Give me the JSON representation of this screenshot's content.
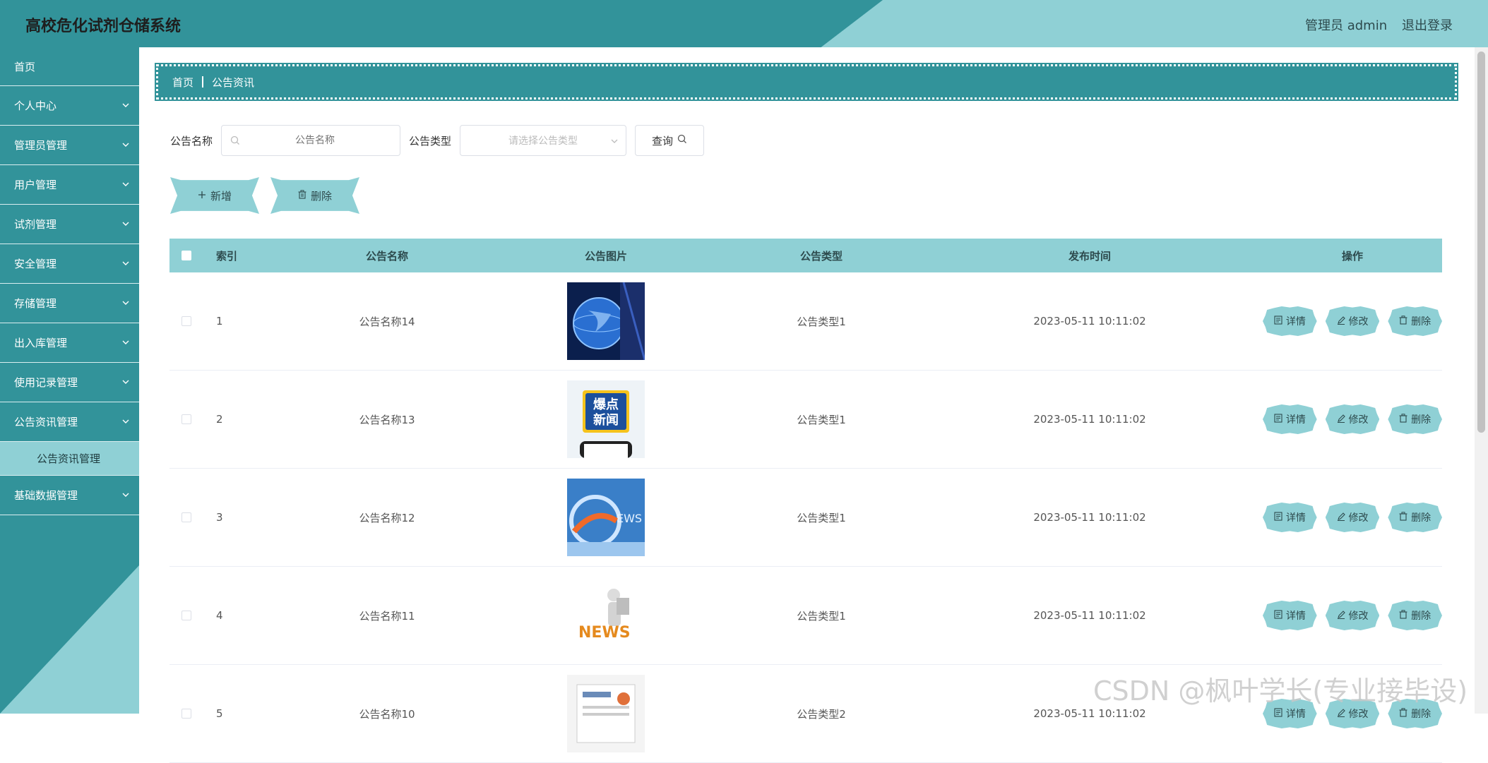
{
  "header": {
    "title": "高校危化试剂仓储系统",
    "user_label": "管理员 admin",
    "logout_label": "退出登录",
    "colors": {
      "dark": "#32939a",
      "light": "#8fd0d5"
    }
  },
  "sidebar": {
    "items": [
      {
        "label": "首页",
        "has_chevron": false
      },
      {
        "label": "个人中心",
        "has_chevron": true
      },
      {
        "label": "管理员管理",
        "has_chevron": true
      },
      {
        "label": "用户管理",
        "has_chevron": true
      },
      {
        "label": "试剂管理",
        "has_chevron": true
      },
      {
        "label": "安全管理",
        "has_chevron": true
      },
      {
        "label": "存储管理",
        "has_chevron": true
      },
      {
        "label": "出入库管理",
        "has_chevron": true
      },
      {
        "label": "使用记录管理",
        "has_chevron": true
      },
      {
        "label": "公告资讯管理",
        "has_chevron": true
      },
      {
        "label": "基础数据管理",
        "has_chevron": true
      }
    ],
    "submenu_label": "公告资讯管理"
  },
  "breadcrumb": {
    "home": "首页",
    "current": "公告资讯"
  },
  "search": {
    "name_label": "公告名称",
    "name_placeholder": "公告名称",
    "type_label": "公告类型",
    "type_placeholder": "请选择公告类型",
    "query_label": "查询"
  },
  "actions": {
    "add_label": "新增",
    "delete_label": "删除"
  },
  "table": {
    "headers": {
      "index": "索引",
      "name": "公告名称",
      "image": "公告图片",
      "type": "公告类型",
      "time": "发布时间",
      "ops": "操作"
    },
    "ops": {
      "detail": "详情",
      "edit": "修改",
      "delete": "删除"
    },
    "rows": [
      {
        "index": "1",
        "name": "公告名称14",
        "type": "公告类型1",
        "time": "2023-05-11 10:11:02",
        "image": "globe-news-image"
      },
      {
        "index": "2",
        "name": "公告名称13",
        "type": "公告类型1",
        "time": "2023-05-11 10:11:02",
        "image": "breaking-news-image",
        "image_text": "爆点\n新闻"
      },
      {
        "index": "3",
        "name": "公告名称12",
        "type": "公告类型1",
        "time": "2023-05-11 10:11:02",
        "image": "news-broadcast-image"
      },
      {
        "index": "4",
        "name": "公告名称11",
        "type": "公告类型1",
        "time": "2023-05-11 10:11:02",
        "image": "news-figure-image",
        "image_text": "NEWS"
      },
      {
        "index": "5",
        "name": "公告名称10",
        "type": "公告类型2",
        "time": "2023-05-11 10:11:02",
        "image": "newspaper-image"
      }
    ]
  },
  "watermark": "CSDN @枫叶学长(专业接毕设)"
}
